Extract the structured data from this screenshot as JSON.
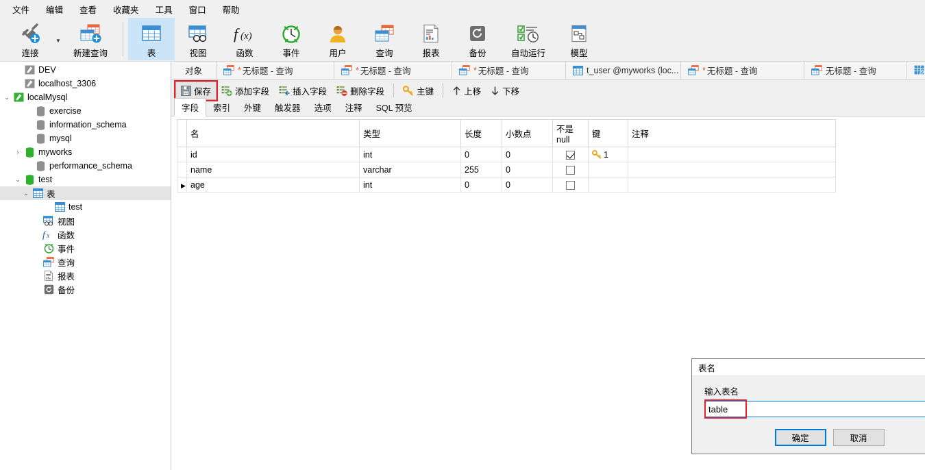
{
  "menubar": {
    "items": [
      {
        "label": "文件",
        "name": "menu-file"
      },
      {
        "label": "编辑",
        "name": "menu-edit"
      },
      {
        "label": "查看",
        "name": "menu-view"
      },
      {
        "label": "收藏夹",
        "name": "menu-favorites"
      },
      {
        "label": "工具",
        "name": "menu-tools"
      },
      {
        "label": "窗口",
        "name": "menu-window"
      },
      {
        "label": "帮助",
        "name": "menu-help"
      }
    ]
  },
  "ribbon": {
    "buttons": [
      {
        "label": "连接",
        "icon": "connection-icon"
      },
      {
        "label": "新建查询",
        "icon": "new-query-icon"
      },
      {
        "label": "表",
        "icon": "table-icon"
      },
      {
        "label": "视图",
        "icon": "view-icon"
      },
      {
        "label": "函数",
        "icon": "function-icon"
      },
      {
        "label": "事件",
        "icon": "event-icon"
      },
      {
        "label": "用户",
        "icon": "user-icon"
      },
      {
        "label": "查询",
        "icon": "query-icon"
      },
      {
        "label": "报表",
        "icon": "report-icon"
      },
      {
        "label": "备份",
        "icon": "backup-icon"
      },
      {
        "label": "自动运行",
        "icon": "automation-icon"
      },
      {
        "label": "模型",
        "icon": "model-icon"
      }
    ],
    "selected": "表"
  },
  "sidebar": {
    "items": [
      {
        "label": "DEV",
        "icon": "connection-gray-icon",
        "indent": 0,
        "twisty": "",
        "selected": false
      },
      {
        "label": "localhost_3306",
        "icon": "connection-gray-icon",
        "indent": 0,
        "twisty": "",
        "selected": false
      },
      {
        "label": "localMysql",
        "icon": "connection-green-icon",
        "indent": 0,
        "twisty": "expanded",
        "selected": false
      },
      {
        "label": "exercise",
        "icon": "database-gray-icon",
        "indent": 1,
        "twisty": "",
        "selected": false
      },
      {
        "label": "information_schema",
        "icon": "database-gray-icon",
        "indent": 1,
        "twisty": "",
        "selected": false
      },
      {
        "label": "mysql",
        "icon": "database-gray-icon",
        "indent": 1,
        "twisty": "",
        "selected": false
      },
      {
        "label": "myworks",
        "icon": "database-green-icon",
        "indent": 1,
        "twisty": "collapsed",
        "selected": false
      },
      {
        "label": "performance_schema",
        "icon": "database-gray-icon",
        "indent": 1,
        "twisty": "",
        "selected": false
      },
      {
        "label": "test",
        "icon": "database-green-icon",
        "indent": 1,
        "twisty": "expanded",
        "selected": false
      },
      {
        "label": "表",
        "icon": "table-icon",
        "indent": 2,
        "twisty": "expanded",
        "selected": true
      },
      {
        "label": "test",
        "icon": "table-icon",
        "indent": 3,
        "twisty": "",
        "selected": false
      },
      {
        "label": "视图",
        "icon": "view-icon",
        "indent": 2,
        "twisty": "",
        "selected": false
      },
      {
        "label": "函数",
        "icon": "function-icon",
        "indent": 2,
        "twisty": "",
        "selected": false
      },
      {
        "label": "事件",
        "icon": "event-icon",
        "indent": 2,
        "twisty": "",
        "selected": false
      },
      {
        "label": "查询",
        "icon": "query-icon",
        "indent": 2,
        "twisty": "",
        "selected": false
      },
      {
        "label": "报表",
        "icon": "report-icon",
        "indent": 2,
        "twisty": "",
        "selected": false
      },
      {
        "label": "备份",
        "icon": "backup-icon",
        "indent": 2,
        "twisty": "",
        "selected": false
      }
    ]
  },
  "tabstrip": {
    "tabs": [
      {
        "label": "对象",
        "icon": "",
        "modified": false,
        "kind": "object"
      },
      {
        "label": "无标题 - 查询",
        "icon": "query-icon",
        "modified": true,
        "kind": "query"
      },
      {
        "label": "无标题 - 查询",
        "icon": "query-icon",
        "modified": true,
        "kind": "query"
      },
      {
        "label": "无标题 - 查询",
        "icon": "query-icon",
        "modified": true,
        "kind": "query"
      },
      {
        "label": "t_user @myworks (loc...",
        "icon": "table-icon",
        "modified": false,
        "kind": "table"
      },
      {
        "label": "无标题 - 查询",
        "icon": "query-icon",
        "modified": true,
        "kind": "query"
      },
      {
        "label": "无标题 - 查询",
        "icon": "query-icon",
        "modified": false,
        "kind": "query"
      }
    ]
  },
  "designer_toolbar": {
    "buttons": [
      {
        "label": "保存",
        "icon": "save-icon",
        "highlighted": true
      },
      {
        "label": "添加字段",
        "icon": "add-field-icon",
        "highlighted": false
      },
      {
        "label": "插入字段",
        "icon": "insert-field-icon",
        "highlighted": false
      },
      {
        "label": "删除字段",
        "icon": "delete-field-icon",
        "highlighted": false
      },
      {
        "label": "主键",
        "icon": "primary-key-icon",
        "highlighted": false
      },
      {
        "label": "上移",
        "icon": "move-up-icon",
        "highlighted": false
      },
      {
        "label": "下移",
        "icon": "move-down-icon",
        "highlighted": false
      }
    ]
  },
  "inner_tabs": {
    "tabs": [
      "字段",
      "索引",
      "外键",
      "触发器",
      "选项",
      "注释",
      "SQL 预览"
    ],
    "active": "字段"
  },
  "field_grid": {
    "columns": [
      "名",
      "类型",
      "长度",
      "小数点",
      "不是 null",
      "键",
      "注释"
    ],
    "rows": [
      {
        "marker": false,
        "name": "id",
        "type": "int",
        "length": "0",
        "decimals": "0",
        "not_null": true,
        "key": "1",
        "comment": ""
      },
      {
        "marker": false,
        "name": "name",
        "type": "varchar",
        "length": "255",
        "decimals": "0",
        "not_null": false,
        "key": "",
        "comment": ""
      },
      {
        "marker": true,
        "name": "age",
        "type": "int",
        "length": "0",
        "decimals": "0",
        "not_null": false,
        "key": "",
        "comment": ""
      }
    ]
  },
  "dialog": {
    "title": "表名",
    "close_label": "✕",
    "field_label": "输入表名",
    "input_value": "table",
    "input_placeholder": "",
    "ok_label": "确定",
    "cancel_label": "取消"
  },
  "colors": {
    "accent_blue": "#0078d7",
    "highlight_red": "#ee1c25",
    "ribbon_bg": "#f0f0f0",
    "selected_tab": "#cce4f7",
    "tree_selected": "#e4e4e4"
  }
}
